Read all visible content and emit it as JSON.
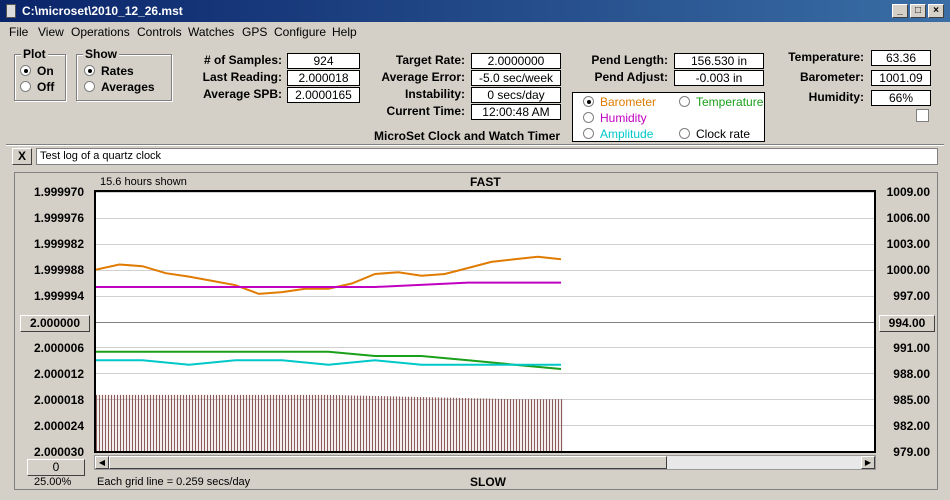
{
  "window": {
    "title": "C:\\microset\\2010_12_26.mst"
  },
  "menu": [
    "File",
    "View",
    "Operations",
    "Controls",
    "Watches",
    "GPS",
    "Configure",
    "Help"
  ],
  "plot_group": {
    "title": "Plot",
    "on": "On",
    "off": "Off",
    "selected": "On"
  },
  "show_group": {
    "title": "Show",
    "rates": "Rates",
    "averages": "Averages",
    "selected": "Rates"
  },
  "stats": {
    "samples_label": "# of Samples:",
    "samples": "924",
    "last_label": "Last Reading:",
    "last": "2.000018",
    "avg_spb_label": "Average SPB:",
    "avg_spb": "2.0000165"
  },
  "rate": {
    "target_label": "Target Rate:",
    "target": "2.0000000",
    "avg_error_label": "Average Error:",
    "avg_error": "-5.0 sec/week",
    "instability_label": "Instability:",
    "instability": "0 secs/day",
    "time_label": "Current Time:",
    "time": "12:00:48 AM"
  },
  "pendulum": {
    "length_label": "Pend Length:",
    "length": "156.530 in",
    "adjust_label": "Pend Adjust:",
    "adjust": "-0.003 in"
  },
  "environment": {
    "temp_label": "Temperature:",
    "temp": "63.36",
    "baro_label": "Barometer:",
    "baro": "1001.09",
    "humidity_label": "Humidity:",
    "humidity": "66%"
  },
  "subtitle": "MicroSet Clock and Watch Timer",
  "sensor_select": {
    "selected": "Barometer",
    "options": [
      {
        "label": "Barometer",
        "color": "#e07b00"
      },
      {
        "label": "Temperature",
        "color": "#1aa01a"
      },
      {
        "label": "Humidity",
        "color": "#c000c0"
      },
      {
        "label": "Amplitude",
        "color": "#00c8c8"
      },
      {
        "label": "Clock rate",
        "color": "#000000"
      }
    ]
  },
  "log": {
    "close": "X",
    "text": "Test log of a quartz clock"
  },
  "chart_header": {
    "hours_shown": "15.6 hours shown",
    "fast": "FAST",
    "slow": "SLOW"
  },
  "footer": {
    "grid_info": "Each grid line = 0.259 secs/day",
    "left_button": "0",
    "zoom": "25.00%"
  },
  "chart_data": {
    "type": "line",
    "left_axis_ticks": [
      "1.999970",
      "1.999976",
      "1.999982",
      "1.999988",
      "1.999994",
      "2.000000",
      "2.000006",
      "2.000012",
      "2.000018",
      "2.000024",
      "2.000030"
    ],
    "right_axis_ticks": [
      "1009.00",
      "1006.00",
      "1003.00",
      "1000.00",
      "997.00",
      "994.00",
      "991.00",
      "988.00",
      "985.00",
      "982.00",
      "979.00"
    ],
    "left_center_button": "2.000000",
    "right_center_button": "994.00",
    "ylim_left": [
      1.99997,
      2.00003
    ],
    "ylim_right": [
      979.0,
      1009.0
    ],
    "grid": true,
    "series": [
      {
        "name": "Barometer",
        "color": "#e07b00",
        "axis": "right",
        "x": [
          0,
          0.05,
          0.1,
          0.15,
          0.2,
          0.25,
          0.3,
          0.35,
          0.4,
          0.45,
          0.5,
          0.55,
          0.6,
          0.65,
          0.7,
          0.75,
          0.8,
          0.85,
          0.9,
          0.95,
          1.0
        ],
        "y": [
          1000.0,
          1000.6,
          1000.4,
          999.6,
          999.2,
          998.7,
          998.2,
          997.2,
          997.4,
          997.8,
          997.8,
          998.4,
          999.5,
          999.7,
          999.3,
          999.5,
          1000.2,
          1000.9,
          1001.2,
          1001.5,
          1001.2
        ]
      },
      {
        "name": "Humidity",
        "color": "#c000c0",
        "axis": "left",
        "x": [
          0,
          0.2,
          0.4,
          0.6,
          0.8,
          0.9,
          1.0
        ],
        "y": [
          1.999992,
          1.999992,
          1.999992,
          1.999992,
          1.999991,
          1.999991,
          1.999991
        ]
      },
      {
        "name": "Temperature",
        "color": "#1aa01a",
        "axis": "left",
        "x": [
          0,
          0.1,
          0.2,
          0.3,
          0.4,
          0.5,
          0.6,
          0.7,
          0.8,
          0.9,
          1.0
        ],
        "y": [
          2.000007,
          2.000007,
          2.000007,
          2.000007,
          2.000007,
          2.000007,
          2.000008,
          2.000008,
          2.000009,
          2.00001,
          2.000011
        ]
      },
      {
        "name": "Amplitude",
        "color": "#00c8c8",
        "axis": "left",
        "x": [
          0,
          0.1,
          0.2,
          0.3,
          0.4,
          0.5,
          0.6,
          0.7,
          0.8,
          0.9,
          1.0
        ],
        "y": [
          2.000009,
          2.000009,
          2.00001,
          2.000009,
          2.000009,
          2.00001,
          2.000009,
          2.00001,
          2.00001,
          2.00001,
          2.00001
        ]
      },
      {
        "name": "Clock rate",
        "color": "#8b5a5a",
        "axis": "left",
        "style": "bars",
        "x": [
          0,
          0.5,
          0.9,
          1.0
        ],
        "y": [
          2.000017,
          2.000017,
          2.000018,
          2.000018
        ]
      }
    ]
  }
}
